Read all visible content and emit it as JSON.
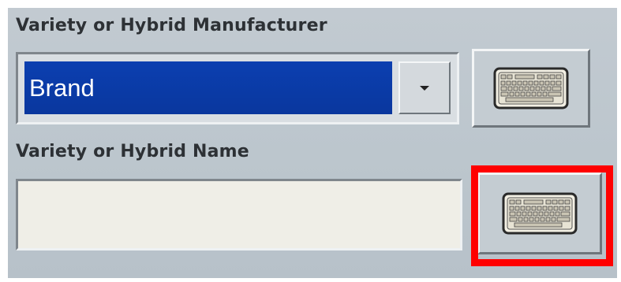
{
  "form": {
    "manufacturer": {
      "label": "Variety or Hybrid Manufacturer",
      "selected_value": "Brand"
    },
    "name": {
      "label": "Variety or Hybrid Name",
      "value": ""
    }
  },
  "icons": {
    "dropdown_arrow": "chevron-down-icon",
    "keyboard": "keyboard-icon"
  },
  "colors": {
    "selection_bg": "#0a3aa6",
    "highlight_border": "#ff0000",
    "panel_bg": "#bfc8cf",
    "input_bg": "#efeee7"
  }
}
